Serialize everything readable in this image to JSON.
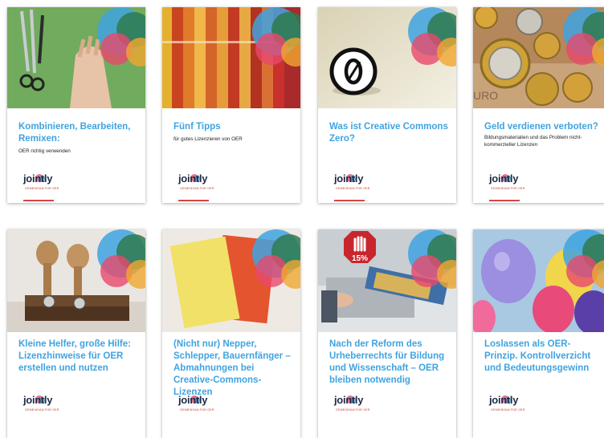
{
  "cards": [
    {
      "title": "Kombinieren, Bearbeiten, Remixen:",
      "subtitle": "OER richtig verwenden",
      "logo": "jointly",
      "tagline": "GEMEINSAM FÜR OER",
      "image": "scissors-hand-green"
    },
    {
      "title": "Fünf Tipps",
      "subtitle": "für gutes Lizenzieren von OER",
      "logo": "jointly",
      "tagline": "GEMEINSAM FÜR OER",
      "image": "colored-pencils"
    },
    {
      "title": "Was ist Creative Commons Zero?",
      "subtitle": "",
      "logo": "jointly",
      "tagline": "GEMEINSAM FÜR OER",
      "image": "cc-zero-icon"
    },
    {
      "title": "Geld verdienen verboten?",
      "subtitle": "Bildungsmaterialien und das Problem nicht-kommerzieller Lizenzen",
      "logo": "jointly",
      "tagline": "GEMEINSAM FÜR OER",
      "image": "euro-coins"
    },
    {
      "title": "Kleine Helfer, große Hilfe: Lizenzhinweise für OER erstellen und nutzen",
      "subtitle": "",
      "logo": "jointly",
      "tagline": "GEMEINSAM FÜR OER",
      "image": "rubber-stamps"
    },
    {
      "title": "(Nicht nur) Nepper, Schlepper, Bauernfänger – Abmahnungen bei Creative-Commons-Lizenzen",
      "subtitle": "",
      "logo": "jointly",
      "tagline": "GEMEINSAM FÜR OER",
      "image": "yellow-red-cards"
    },
    {
      "title": "Nach der Reform des Urheberrechts für Bildung und Wissenschaft – OER bleiben notwendig",
      "subtitle": "",
      "logo": "jointly",
      "tagline": "GEMEINSAM FÜR OER",
      "image": "copier-stop-15",
      "badge": "15%"
    },
    {
      "title": "Loslassen als OER-Prinzip. Kontrollverzicht und Bedeutungsgewinn",
      "subtitle": "",
      "logo": "jointly",
      "tagline": "GEMEINSAM FÜR OER",
      "image": "balloons"
    }
  ],
  "colors": {
    "title": "#3fa3e0",
    "logo": "#1f2a44",
    "accent": "#d64545"
  }
}
